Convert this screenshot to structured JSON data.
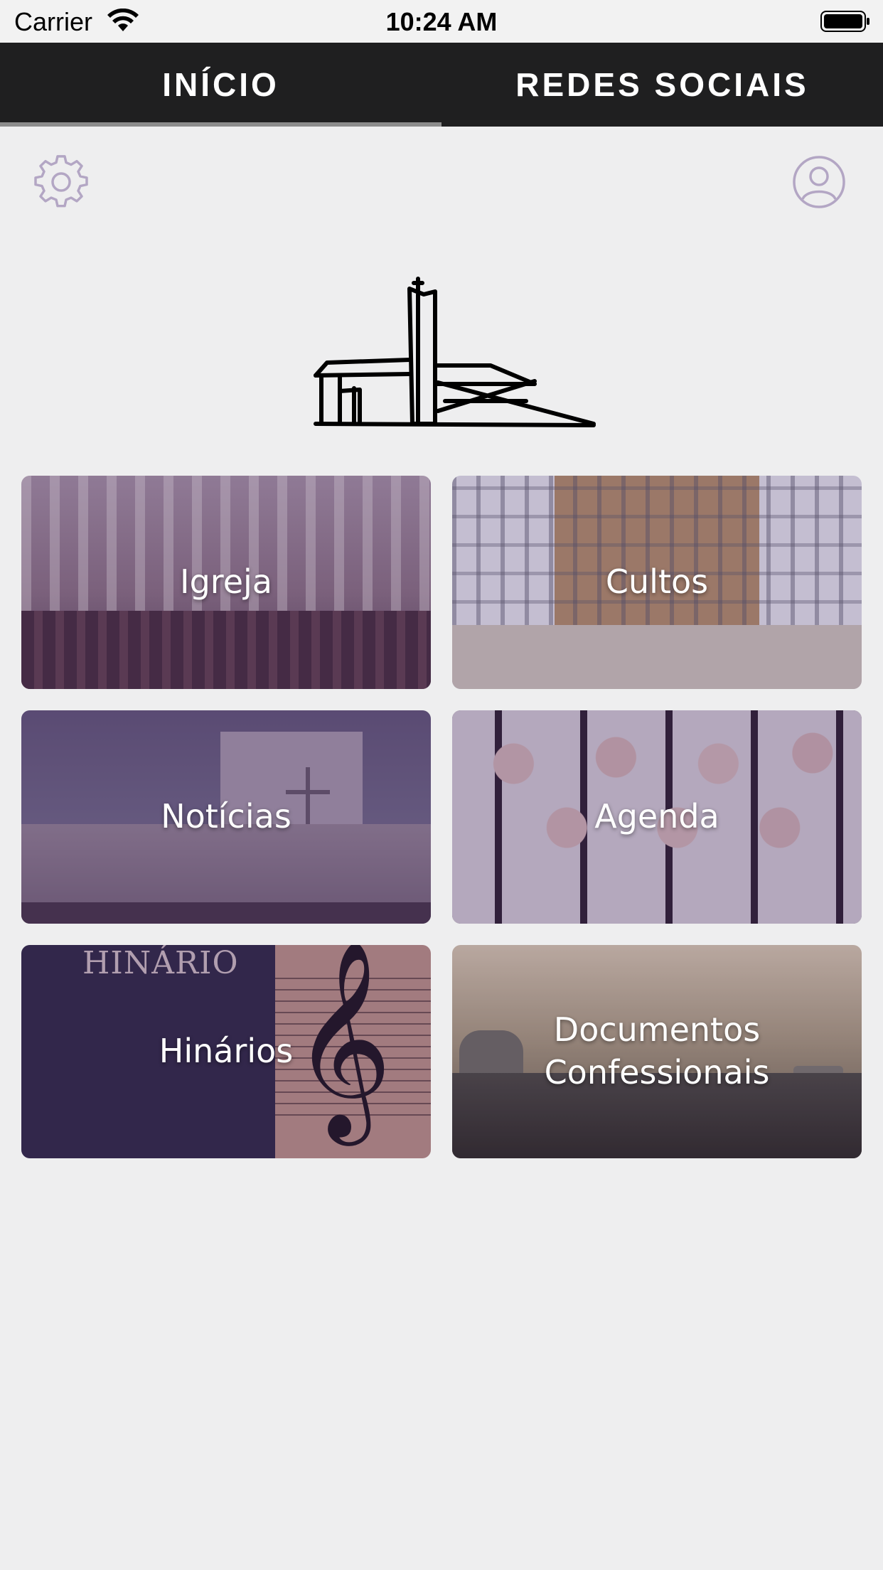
{
  "status_bar": {
    "carrier": "Carrier",
    "time": "10:24 AM"
  },
  "tabs": [
    {
      "label": "INÍCIO",
      "selected": true
    },
    {
      "label": "REDES SOCIAIS",
      "selected": false
    }
  ],
  "header": {
    "settings_icon": "gear-icon",
    "profile_icon": "user-circle-icon",
    "icon_color": "#b3a6c4"
  },
  "logo": {
    "icon": "church-building-logo"
  },
  "cards": [
    {
      "label": "Igreja"
    },
    {
      "label": "Cultos"
    },
    {
      "label": "Notícias"
    },
    {
      "label": "Agenda"
    },
    {
      "label": "Hinários",
      "image_text": "HINÁRIO"
    },
    {
      "label": "Documentos\nConfessionais"
    }
  ],
  "colors": {
    "tab_bar": "#1f1f20",
    "tab_indicator": "#8c8c8c",
    "background": "#eeeeef",
    "card_overlay": "#3c1e50"
  }
}
